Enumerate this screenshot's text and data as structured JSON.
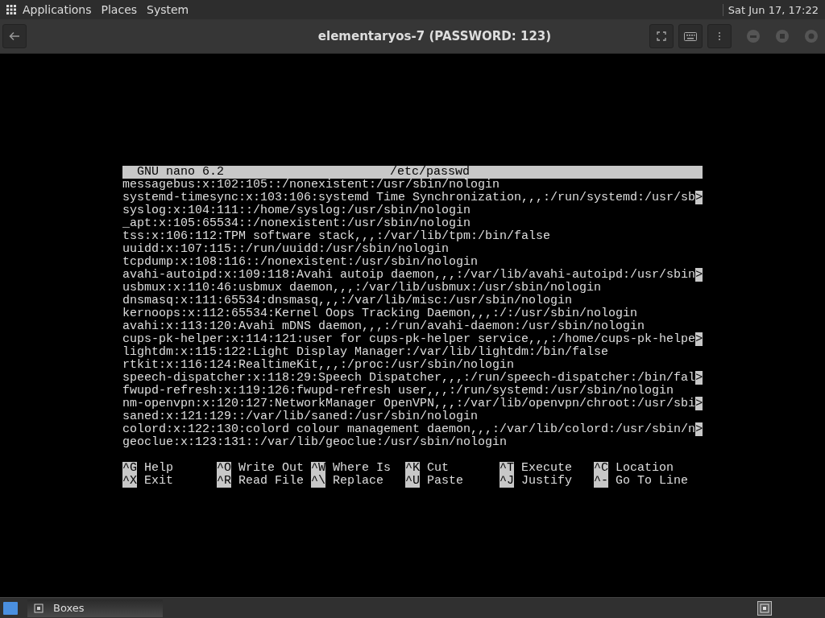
{
  "top_panel": {
    "menus": [
      "Applications",
      "Places",
      "System"
    ],
    "clock": "Sat Jun 17, 17:22"
  },
  "header": {
    "title": "elementaryos-7 (PASSWORD: 123)"
  },
  "nano": {
    "program": "GNU nano 6.2",
    "file": "/etc/passwd",
    "lines": [
      {
        "text": "messagebus:x:102:105::/nonexistent:/usr/sbin/nologin"
      },
      {
        "text": "systemd-timesync:x:103:106:systemd Time Synchronization,,,:/run/systemd:/usr/sb",
        "more": ">"
      },
      {
        "text": "syslog:x:104:111::/home/syslog:/usr/sbin/nologin"
      },
      {
        "text": "_apt:x:105:65534::/nonexistent:/usr/sbin/nologin"
      },
      {
        "text": "tss:x:106:112:TPM software stack,,,:/var/lib/tpm:/bin/false"
      },
      {
        "text": "uuidd:x:107:115::/run/uuidd:/usr/sbin/nologin"
      },
      {
        "text": "tcpdump:x:108:116::/nonexistent:/usr/sbin/nologin"
      },
      {
        "text": "avahi-autoipd:x:109:118:Avahi autoip daemon,,,:/var/lib/avahi-autoipd:/usr/sbin",
        "more": ">"
      },
      {
        "text": "usbmux:x:110:46:usbmux daemon,,,:/var/lib/usbmux:/usr/sbin/nologin"
      },
      {
        "text": "dnsmasq:x:111:65534:dnsmasq,,,:/var/lib/misc:/usr/sbin/nologin"
      },
      {
        "text": "kernoops:x:112:65534:Kernel Oops Tracking Daemon,,,:/:/usr/sbin/nologin"
      },
      {
        "text": "avahi:x:113:120:Avahi mDNS daemon,,,:/run/avahi-daemon:/usr/sbin/nologin"
      },
      {
        "text": "cups-pk-helper:x:114:121:user for cups-pk-helper service,,,:/home/cups-pk-helpe",
        "more": ">"
      },
      {
        "text": "lightdm:x:115:122:Light Display Manager:/var/lib/lightdm:/bin/false"
      },
      {
        "text": "rtkit:x:116:124:RealtimeKit,,,:/proc:/usr/sbin/nologin"
      },
      {
        "text": "speech-dispatcher:x:118:29:Speech Dispatcher,,,:/run/speech-dispatcher:/bin/fal",
        "more": ">"
      },
      {
        "text": "fwupd-refresh:x:119:126:fwupd-refresh user,,,:/run/systemd:/usr/sbin/nologin"
      },
      {
        "text": "nm-openvpn:x:120:127:NetworkManager OpenVPN,,,:/var/lib/openvpn/chroot:/usr/sbi",
        "more": ">"
      },
      {
        "text": "saned:x:121:129::/var/lib/saned:/usr/sbin/nologin"
      },
      {
        "text": "colord:x:122:130:colord colour management daemon,,,:/var/lib/colord:/usr/sbin/n",
        "more": ">"
      },
      {
        "text": "geoclue:x:123:131::/var/lib/geoclue:/usr/sbin/nologin"
      }
    ],
    "shortcuts": [
      {
        "key": "^G",
        "label": "Help"
      },
      {
        "key": "^O",
        "label": "Write Out"
      },
      {
        "key": "^W",
        "label": "Where Is"
      },
      {
        "key": "^K",
        "label": "Cut"
      },
      {
        "key": "^T",
        "label": "Execute"
      },
      {
        "key": "^C",
        "label": "Location"
      },
      {
        "key": "^X",
        "label": "Exit"
      },
      {
        "key": "^R",
        "label": "Read File"
      },
      {
        "key": "^\\",
        "label": "Replace"
      },
      {
        "key": "^U",
        "label": "Paste"
      },
      {
        "key": "^J",
        "label": "Justify"
      },
      {
        "key": "^-",
        "label": "Go To Line"
      }
    ]
  },
  "taskbar": {
    "window": "Boxes"
  }
}
